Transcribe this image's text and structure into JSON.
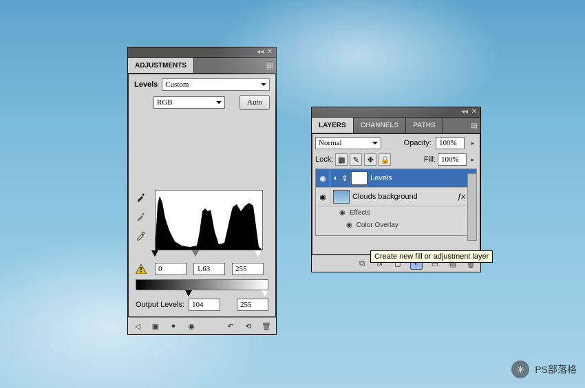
{
  "adjustments": {
    "tab": "ADJUSTMENTS",
    "preset_label": "Levels",
    "preset_value": "Custom",
    "channel": "RGB",
    "auto": "Auto",
    "shadows": "0",
    "mid": "1.63",
    "highlights": "255",
    "output_label": "Output Levels:",
    "out_lo": "104",
    "out_hi": "255"
  },
  "layers": {
    "tabs": [
      "LAYERS",
      "CHANNELS",
      "PATHS"
    ],
    "active_tab": 0,
    "blend_mode": "Normal",
    "opacity_label": "Opacity:",
    "opacity": "100%",
    "lock_label": "Lock:",
    "fill_label": "Fill:",
    "fill": "100%",
    "items": [
      {
        "name": "Levels",
        "type": "adjustment",
        "selected": true
      },
      {
        "name": "Clouds background",
        "type": "image",
        "selected": false,
        "has_fx": true
      }
    ],
    "effects_label": "Effects",
    "color_overlay_label": "Color Overlay"
  },
  "tooltip": "Create new fill or adjustment layer",
  "watermark": "PS部落格"
}
